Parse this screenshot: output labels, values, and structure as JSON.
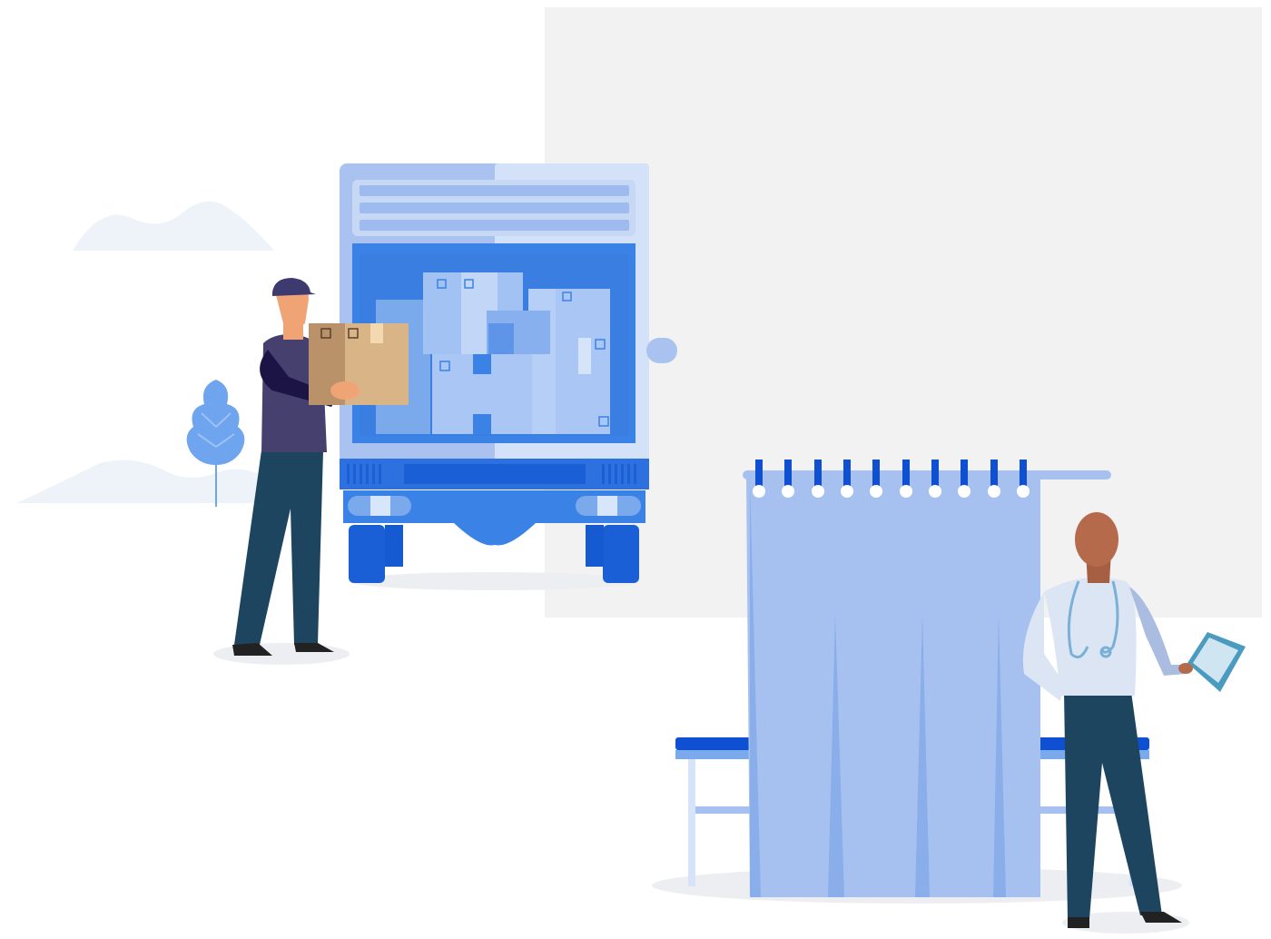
{
  "illustration": {
    "colors": {
      "background": "#ffffff",
      "panel": "#f2f2f2",
      "truck_light": "#a9c2ef",
      "truck_mid": "#3b82e6",
      "truck_dark": "#1a5fd6",
      "curtain": "#a6c1f0",
      "curtain_fold": "#8aaeea",
      "bench": "#0f4fd1",
      "box": "#d8b487",
      "box_shade": "#b9926a",
      "worker_shirt": "#46406e",
      "worker_pants": "#1d4560",
      "doctor_coat": "#dce5f3",
      "doctor_skin": "#b56a4b",
      "shadow": "#eceef1",
      "cloud": "#eef3f9",
      "plant": "#6fa4ee"
    },
    "icons": [
      "delivery-truck-icon",
      "cardboard-box-icon",
      "plant-icon",
      "cloud-icon",
      "hospital-curtain-icon",
      "stethoscope-icon",
      "tablet-icon"
    ]
  }
}
